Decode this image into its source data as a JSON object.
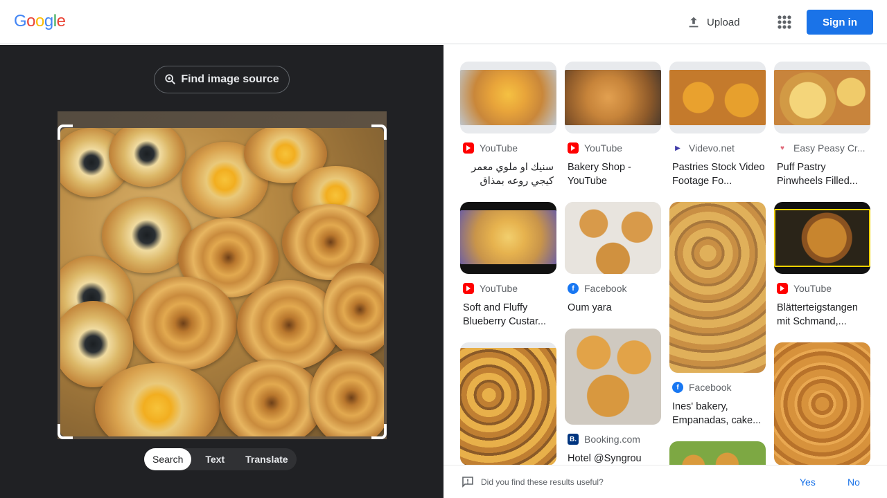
{
  "header": {
    "logo_letters": [
      "G",
      "o",
      "o",
      "g",
      "l",
      "e"
    ],
    "logo_colors": [
      "#4285f4",
      "#ea4335",
      "#fbbc05",
      "#4285f4",
      "#34a853",
      "#ea4335"
    ],
    "upload_label": "Upload",
    "signin_label": "Sign in"
  },
  "left_panel": {
    "find_source_label": "Find image source",
    "modes": [
      {
        "label": "Search",
        "active": true
      },
      {
        "label": "Text",
        "active": false
      },
      {
        "label": "Translate",
        "active": false
      }
    ]
  },
  "results": {
    "columns": [
      [
        {
          "source": "YouTube",
          "source_icon": "youtube-icon",
          "title": "سنيك او ملوي معمر كيجي روعه بمذاق البيتزا - ...",
          "rtl": true
        },
        {
          "source": "YouTube",
          "source_icon": "youtube-icon",
          "title": "Soft and Fluffy Blueberry Custar..."
        },
        {
          "source": "",
          "source_icon": "",
          "title": ""
        }
      ],
      [
        {
          "source": "YouTube",
          "source_icon": "youtube-icon",
          "title": "Bakery Shop - YouTube"
        },
        {
          "source": "Facebook",
          "source_icon": "facebook-icon",
          "title": "Oum yara"
        },
        {
          "source": "Booking.com",
          "source_icon": "booking-icon",
          "title": "Hotel @Syngrou"
        }
      ],
      [
        {
          "source": "Videvo.net",
          "source_icon": "videvo-icon",
          "title": "Pastries Stock Video Footage Fo..."
        },
        {
          "source": "Facebook",
          "source_icon": "facebook-icon",
          "title": "Ines' bakery, Empanadas, cake..."
        },
        {
          "source": "",
          "source_icon": "",
          "title": ""
        }
      ],
      [
        {
          "source": "Easy Peasy Cr...",
          "source_icon": "easy-peasy-icon",
          "title": "Puff Pastry Pinwheels Filled..."
        },
        {
          "source": "YouTube",
          "source_icon": "youtube-icon",
          "title": "Blätterteigstangen mit Schmand,..."
        },
        {
          "source": "",
          "source_icon": "",
          "title": ""
        }
      ]
    ]
  },
  "feedback": {
    "question": "Did you find these results useful?",
    "yes_label": "Yes",
    "no_label": "No"
  }
}
